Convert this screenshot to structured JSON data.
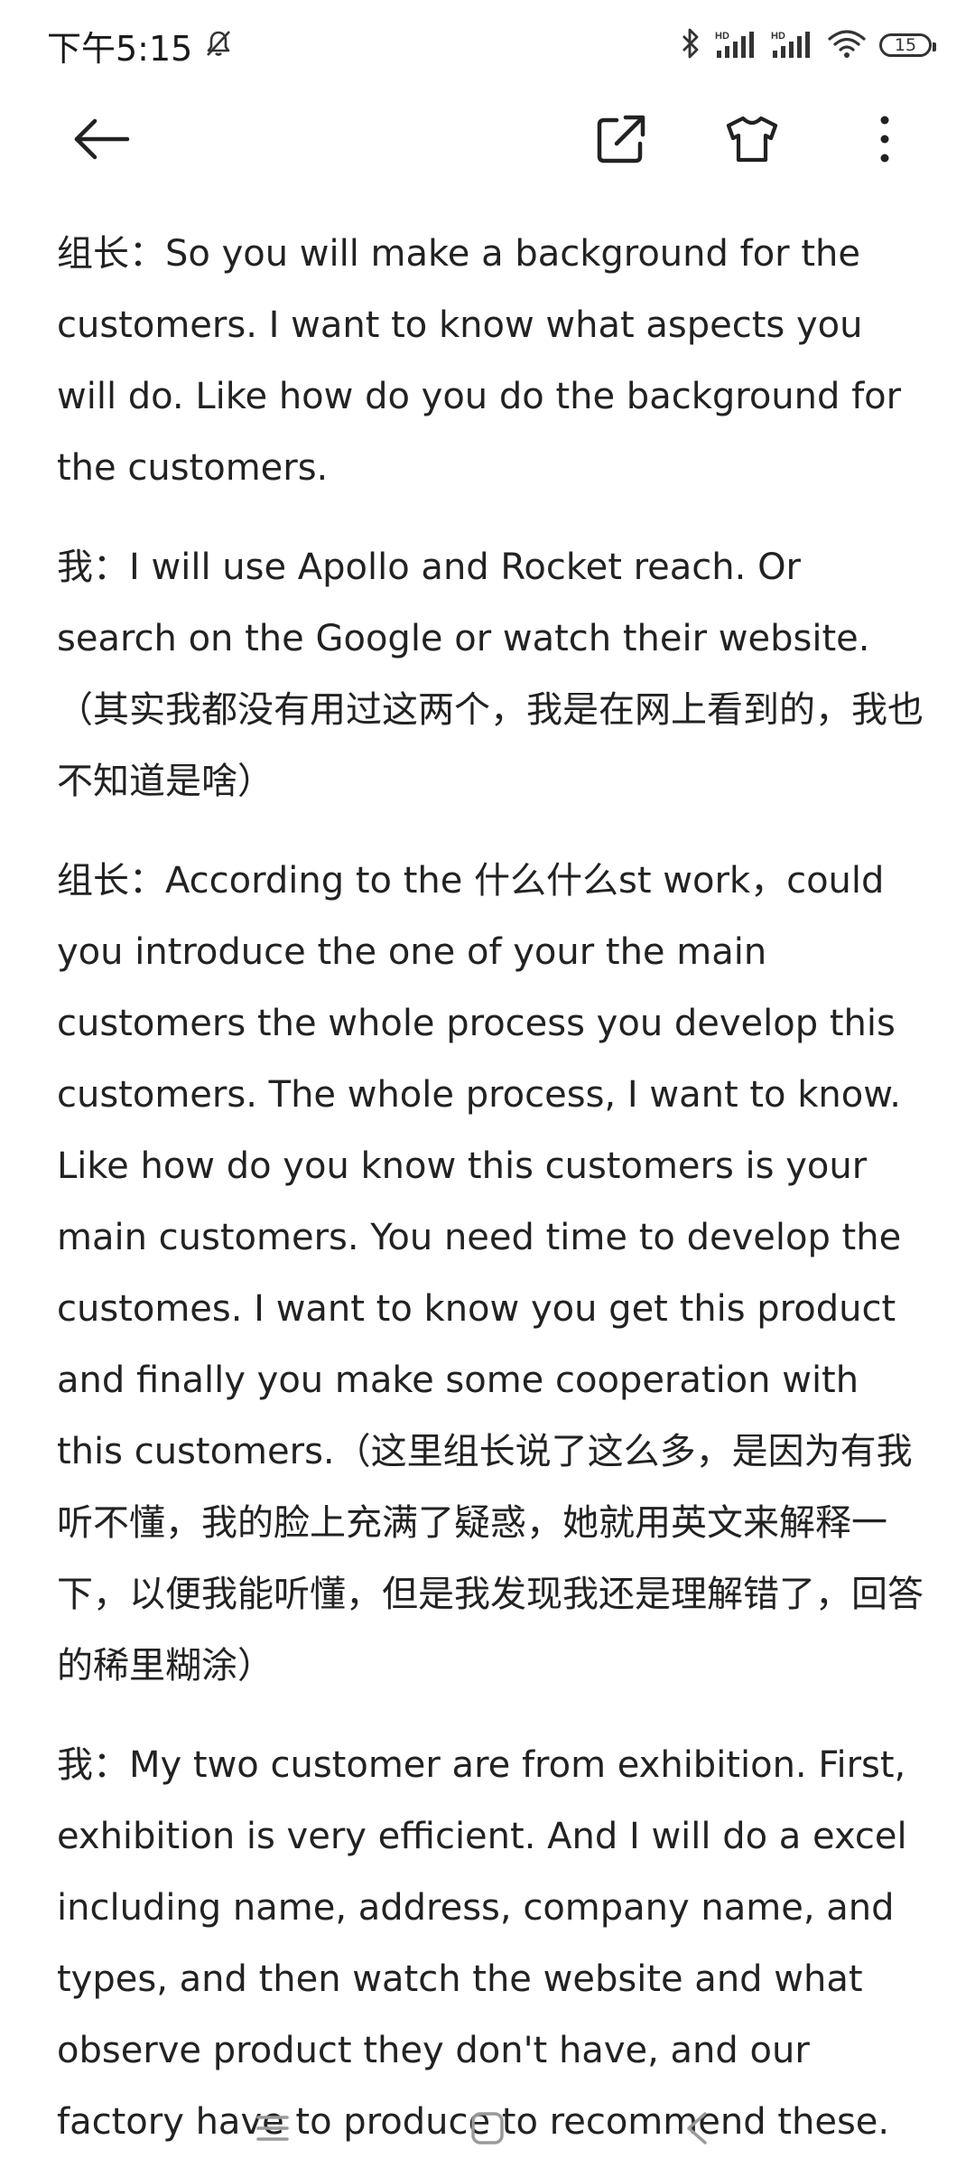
{
  "status_bar": {
    "time": "下午5:15",
    "battery": "15",
    "icons": [
      "mute-bell-icon",
      "bluetooth-icon",
      "signal-hd-icon",
      "signal-hd-icon",
      "wifi-icon",
      "battery-icon"
    ]
  },
  "toolbar": {
    "icons": [
      "back-arrow-icon",
      "share-external-icon",
      "tshirt-theme-icon",
      "more-vertical-icon"
    ]
  },
  "content": {
    "paragraphs": [
      "组长：So you will make a background for the customers. I want to know what aspects you will do. Like how do you do the background for the customers.",
      "我：I will use Apollo and Rocket reach. Or search on the Google or watch their website.（其实我都没有用过这两个，我是在网上看到的，我也不知道是啥）",
      "组长：According to the 什么什么st work，could you introduce the one of your the main customers the whole process you develop this customers. The whole process, I want to know. Like how do you know this customers is your main customers. You need time to develop the customes. I want to know you get this product and finally you make some cooperation with this customers.（这里组长说了这么多，是因为有我听不懂，我的脸上充满了疑惑，她就用英文来解释一下，以便我能听懂，但是我发现我还是理解错了，回答的稀里糊涂）",
      "我：My two customer are from exhibition. First, exhibition is very efficient. And I will do a excel including name, address, company name, and types, and then watch the website and what observe product they don't have, and our factory have to produce to recommend these."
    ]
  },
  "navbar": {
    "icons": [
      "menu-lines-icon",
      "home-square-icon",
      "back-chevron-icon"
    ]
  }
}
